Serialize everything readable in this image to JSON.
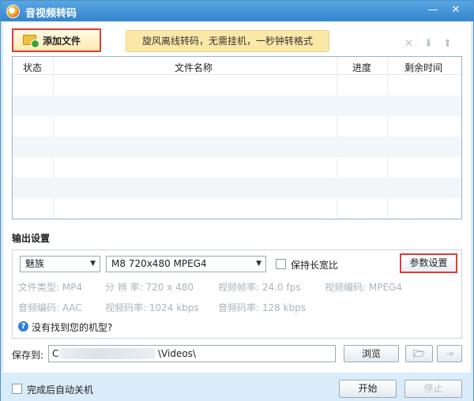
{
  "window": {
    "title": "音视频转码",
    "icon": "app-logo-icon",
    "minimize_glyph": "—",
    "close_glyph": "✕"
  },
  "toolbar": {
    "add_file_label": "添加文件",
    "promo_text": "旋风离线转码，无需挂机，一秒钟转格式",
    "delete_glyph": "✕",
    "down_glyph": "⬇",
    "up_glyph": "⬆"
  },
  "file_list": {
    "columns": [
      "状态",
      "文件名称",
      "进度",
      "剩余时间"
    ],
    "rows": []
  },
  "output": {
    "section_title": "输出设置",
    "device_value": "魅族",
    "preset_value": "M8 720x480 MPEG4",
    "keep_ratio_label": "保持长宽比",
    "keep_ratio_checked": false,
    "param_button": "参数设置",
    "info": {
      "file_type": "文件类型:  MP4",
      "resolution": "分 辨 率:  720 x 480",
      "frame_rate": "视频帧率:  24.0 fps",
      "video_codec": "视频编码:  MPEG4",
      "audio_codec": "音频编码:  AAC",
      "video_bitrate": "视频码率:  1024 kbps",
      "audio_bitrate": "音频码率:  128 kbps"
    },
    "help_text": "没有找到您的机型?"
  },
  "save": {
    "label": "保存到:",
    "path_prefix": "C",
    "path_suffix": "\\Videos\\",
    "browse_button": "浏览"
  },
  "footer": {
    "auto_shutdown_label": "完成后自动关机",
    "auto_shutdown_checked": false,
    "start_button": "开始",
    "stop_button": "停止"
  },
  "colors": {
    "titlebar": "#3485cd",
    "highlight_border": "#e03b3b",
    "promo_bg": "#fbe7a6",
    "window_bg": "#d9ecfa"
  }
}
